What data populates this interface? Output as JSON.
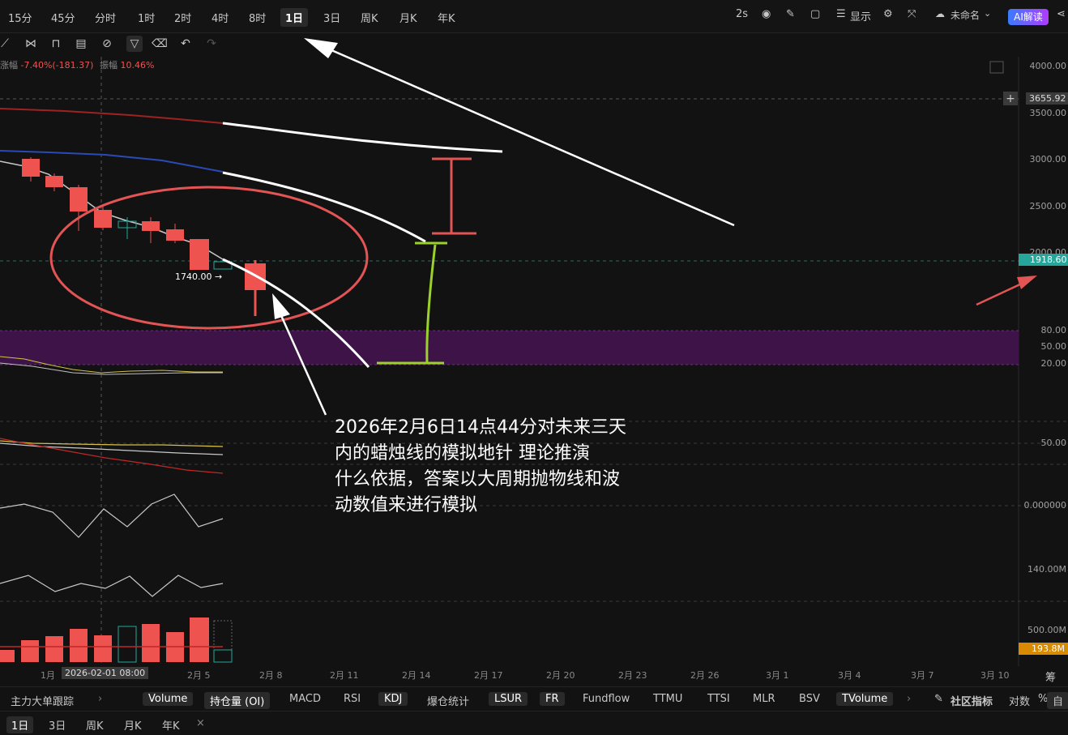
{
  "timeframes": [
    "15分",
    "45分",
    "分时",
    "1时",
    "2时",
    "4时",
    "8时",
    "1日",
    "3日",
    "周K",
    "月K",
    "年K"
  ],
  "active_timeframe_index": 7,
  "top_right": {
    "interval": "2s",
    "display_label": "显示",
    "layout_name": "未命名",
    "ai_label": "AI解读"
  },
  "stats": {
    "change_label": "涨幅",
    "change_value": "-7.40%(-181.37)",
    "amplitude_label": "振幅",
    "amplitude_value": "10.46%"
  },
  "price_axis": [
    "4000.00",
    "3500.00",
    "3000.00",
    "2500.00",
    "2000.00",
    "80.00",
    "50.00",
    "20.00",
    "50.00",
    "0.000000",
    "140.00M",
    "500.00M"
  ],
  "crosshair_price": "3655.92",
  "last_price": "1918.60",
  "volume_tag": "193.8M",
  "low_label": "1740.00 →",
  "x_axis": [
    "1月",
    "2月 5",
    "2月 8",
    "2月 11",
    "2月 14",
    "2月 17",
    "2月 20",
    "2月 23",
    "2月 26",
    "3月 1",
    "3月 4",
    "3月 7",
    "3月 10"
  ],
  "crosshair_date": "2026-02-01 08:00",
  "axis_corner": "筹",
  "annotation": [
    "2026年2月6日14点44分对未来三天",
    "内的蜡烛线的模拟地针 理论推演",
    "什么依据，答案以大周期抛物线和波",
    "动数值来进行模拟"
  ],
  "indicators": {
    "lead": "主力大单跟踪",
    "items": [
      "Volume",
      "持仓量 (OI)",
      "MACD",
      "RSI",
      "KDJ",
      "爆仓统计",
      "LSUR",
      "FR",
      "Fundflow",
      "TTMU",
      "TTSI",
      "MLR",
      "BSV",
      "TVolume"
    ],
    "selected": [
      0,
      1,
      4,
      6,
      7,
      13
    ],
    "community": "社区指标",
    "log": "对数",
    "percent": "%",
    "auto": "自"
  },
  "bottom_tabs": [
    "1日",
    "3日",
    "周K",
    "月K",
    "年K"
  ],
  "bottom_close": "×",
  "colors": {
    "up": "#26a69a",
    "down": "#ef5350",
    "accent_band": "#4a1a55",
    "sell_line": "#b22a2a",
    "blue_line": "#2a4ab5"
  }
}
